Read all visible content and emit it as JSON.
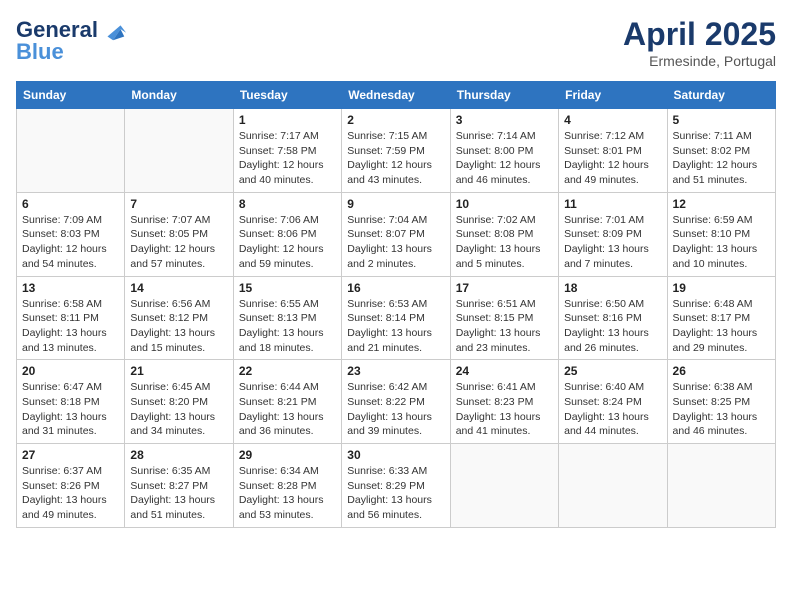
{
  "header": {
    "logo_line1": "General",
    "logo_line2": "Blue",
    "title": "April 2025",
    "subtitle": "Ermesinde, Portugal"
  },
  "columns": [
    "Sunday",
    "Monday",
    "Tuesday",
    "Wednesday",
    "Thursday",
    "Friday",
    "Saturday"
  ],
  "weeks": [
    [
      {
        "day": "",
        "info": ""
      },
      {
        "day": "",
        "info": ""
      },
      {
        "day": "1",
        "info": "Sunrise: 7:17 AM\nSunset: 7:58 PM\nDaylight: 12 hours and 40 minutes."
      },
      {
        "day": "2",
        "info": "Sunrise: 7:15 AM\nSunset: 7:59 PM\nDaylight: 12 hours and 43 minutes."
      },
      {
        "day": "3",
        "info": "Sunrise: 7:14 AM\nSunset: 8:00 PM\nDaylight: 12 hours and 46 minutes."
      },
      {
        "day": "4",
        "info": "Sunrise: 7:12 AM\nSunset: 8:01 PM\nDaylight: 12 hours and 49 minutes."
      },
      {
        "day": "5",
        "info": "Sunrise: 7:11 AM\nSunset: 8:02 PM\nDaylight: 12 hours and 51 minutes."
      }
    ],
    [
      {
        "day": "6",
        "info": "Sunrise: 7:09 AM\nSunset: 8:03 PM\nDaylight: 12 hours and 54 minutes."
      },
      {
        "day": "7",
        "info": "Sunrise: 7:07 AM\nSunset: 8:05 PM\nDaylight: 12 hours and 57 minutes."
      },
      {
        "day": "8",
        "info": "Sunrise: 7:06 AM\nSunset: 8:06 PM\nDaylight: 12 hours and 59 minutes."
      },
      {
        "day": "9",
        "info": "Sunrise: 7:04 AM\nSunset: 8:07 PM\nDaylight: 13 hours and 2 minutes."
      },
      {
        "day": "10",
        "info": "Sunrise: 7:02 AM\nSunset: 8:08 PM\nDaylight: 13 hours and 5 minutes."
      },
      {
        "day": "11",
        "info": "Sunrise: 7:01 AM\nSunset: 8:09 PM\nDaylight: 13 hours and 7 minutes."
      },
      {
        "day": "12",
        "info": "Sunrise: 6:59 AM\nSunset: 8:10 PM\nDaylight: 13 hours and 10 minutes."
      }
    ],
    [
      {
        "day": "13",
        "info": "Sunrise: 6:58 AM\nSunset: 8:11 PM\nDaylight: 13 hours and 13 minutes."
      },
      {
        "day": "14",
        "info": "Sunrise: 6:56 AM\nSunset: 8:12 PM\nDaylight: 13 hours and 15 minutes."
      },
      {
        "day": "15",
        "info": "Sunrise: 6:55 AM\nSunset: 8:13 PM\nDaylight: 13 hours and 18 minutes."
      },
      {
        "day": "16",
        "info": "Sunrise: 6:53 AM\nSunset: 8:14 PM\nDaylight: 13 hours and 21 minutes."
      },
      {
        "day": "17",
        "info": "Sunrise: 6:51 AM\nSunset: 8:15 PM\nDaylight: 13 hours and 23 minutes."
      },
      {
        "day": "18",
        "info": "Sunrise: 6:50 AM\nSunset: 8:16 PM\nDaylight: 13 hours and 26 minutes."
      },
      {
        "day": "19",
        "info": "Sunrise: 6:48 AM\nSunset: 8:17 PM\nDaylight: 13 hours and 29 minutes."
      }
    ],
    [
      {
        "day": "20",
        "info": "Sunrise: 6:47 AM\nSunset: 8:18 PM\nDaylight: 13 hours and 31 minutes."
      },
      {
        "day": "21",
        "info": "Sunrise: 6:45 AM\nSunset: 8:20 PM\nDaylight: 13 hours and 34 minutes."
      },
      {
        "day": "22",
        "info": "Sunrise: 6:44 AM\nSunset: 8:21 PM\nDaylight: 13 hours and 36 minutes."
      },
      {
        "day": "23",
        "info": "Sunrise: 6:42 AM\nSunset: 8:22 PM\nDaylight: 13 hours and 39 minutes."
      },
      {
        "day": "24",
        "info": "Sunrise: 6:41 AM\nSunset: 8:23 PM\nDaylight: 13 hours and 41 minutes."
      },
      {
        "day": "25",
        "info": "Sunrise: 6:40 AM\nSunset: 8:24 PM\nDaylight: 13 hours and 44 minutes."
      },
      {
        "day": "26",
        "info": "Sunrise: 6:38 AM\nSunset: 8:25 PM\nDaylight: 13 hours and 46 minutes."
      }
    ],
    [
      {
        "day": "27",
        "info": "Sunrise: 6:37 AM\nSunset: 8:26 PM\nDaylight: 13 hours and 49 minutes."
      },
      {
        "day": "28",
        "info": "Sunrise: 6:35 AM\nSunset: 8:27 PM\nDaylight: 13 hours and 51 minutes."
      },
      {
        "day": "29",
        "info": "Sunrise: 6:34 AM\nSunset: 8:28 PM\nDaylight: 13 hours and 53 minutes."
      },
      {
        "day": "30",
        "info": "Sunrise: 6:33 AM\nSunset: 8:29 PM\nDaylight: 13 hours and 56 minutes."
      },
      {
        "day": "",
        "info": ""
      },
      {
        "day": "",
        "info": ""
      },
      {
        "day": "",
        "info": ""
      }
    ]
  ]
}
